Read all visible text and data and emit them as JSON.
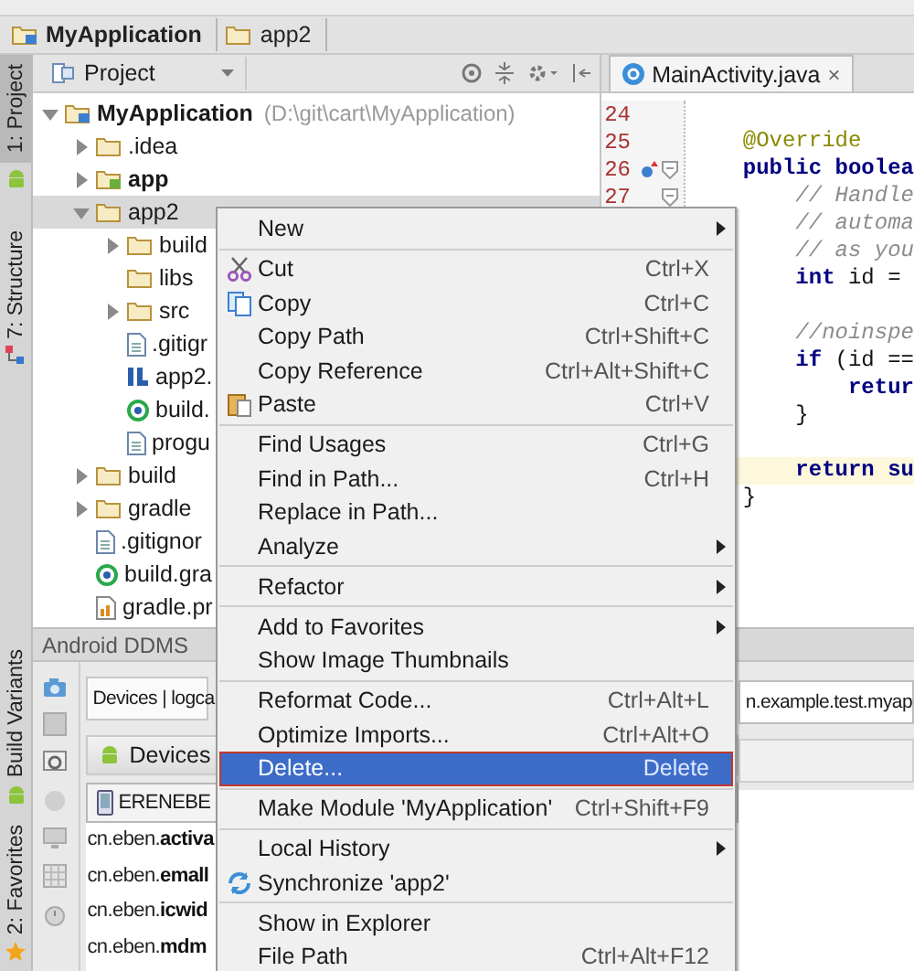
{
  "breadcrumb": [
    {
      "label": "MyApplication",
      "kind": "project"
    },
    {
      "label": "app2",
      "kind": "folder"
    }
  ],
  "sidebar_tabs": [
    {
      "label": "1: Project",
      "selected": true,
      "kind": "project"
    },
    {
      "label": "7: Structure",
      "selected": false,
      "kind": "structure"
    },
    {
      "label": "Build Variants",
      "selected": false,
      "kind": "variants"
    },
    {
      "label": "2: Favorites",
      "selected": false,
      "kind": "favorites"
    }
  ],
  "project_panel": {
    "view": "Project",
    "tree": [
      {
        "label": "MyApplication",
        "path": "(D:\\git\\cart\\MyApplication)",
        "kind": "project",
        "expanded": true,
        "selected": false,
        "children": [
          {
            "label": ".idea",
            "kind": "folder",
            "expanded": false,
            "selected": false
          },
          {
            "label": "app",
            "kind": "module",
            "expanded": false,
            "selected": false
          },
          {
            "label": "app2",
            "kind": "folder",
            "expanded": true,
            "selected": true,
            "children": [
              {
                "label": "build",
                "kind": "folder",
                "expanded": false,
                "selected": false
              },
              {
                "label": "libs",
                "kind": "folder",
                "selected": false
              },
              {
                "label": "src",
                "kind": "folder",
                "expanded": false,
                "selected": false
              },
              {
                "label": ".gitigr",
                "kind": "file",
                "selected": false
              },
              {
                "label": "app2.",
                "kind": "iml",
                "selected": false
              },
              {
                "label": "build.",
                "kind": "gradle",
                "selected": false
              },
              {
                "label": "progu",
                "kind": "file",
                "selected": false
              }
            ]
          },
          {
            "label": "build",
            "kind": "folder",
            "expanded": false,
            "selected": false
          },
          {
            "label": "gradle",
            "kind": "folder",
            "expanded": false,
            "selected": false
          },
          {
            "label": ".gitignor",
            "kind": "file",
            "selected": false
          },
          {
            "label": "build.gra",
            "kind": "gradle",
            "selected": false
          },
          {
            "label": "gradle.pr",
            "kind": "properties",
            "selected": false
          }
        ]
      }
    ]
  },
  "editor": {
    "tab": {
      "label": "MainActivity.java",
      "close": "×"
    },
    "line_numbers": [
      {
        "number": "24",
        "override": false,
        "fold": false
      },
      {
        "number": "25",
        "override": false,
        "fold": false
      },
      {
        "number": "26",
        "override": true,
        "fold": true
      },
      {
        "number": "27",
        "override": false,
        "fold": true
      }
    ],
    "lines": [
      {
        "kind": "blank"
      },
      {
        "text": "    @Override",
        "kind": "annotation",
        "highlighted": false
      },
      {
        "text": "    **public boolea**",
        "kind": "code",
        "highlighted": false
      },
      {
        "text": "        // Handle",
        "kind": "comment",
        "highlighted": false
      },
      {
        "text": "        // automa",
        "kind": "comment",
        "highlighted": false
      },
      {
        "text": "        // as you",
        "kind": "comment",
        "highlighted": false
      },
      {
        "text": "        **int** id =",
        "kind": "code",
        "highlighted": false
      },
      {
        "kind": "blank"
      },
      {
        "text": "        //noinspe",
        "kind": "comment",
        "highlighted": false
      },
      {
        "text": "        **if** (id ==",
        "kind": "code",
        "highlighted": false
      },
      {
        "text": "            **retur**",
        "kind": "code",
        "highlighted": false
      },
      {
        "text": "        }",
        "kind": "code",
        "highlighted": false
      },
      {
        "kind": "blank"
      },
      {
        "text": "        **return su**",
        "kind": "code",
        "highlighted": true
      },
      {
        "text": "    }",
        "kind": "code",
        "highlighted": false
      }
    ]
  },
  "ddms": {
    "title": "Android DDMS",
    "tab": "Devices | logca",
    "devices_header": "Devices",
    "device": "ERENEBE",
    "processes": [
      "cn.eben.**activa**",
      "cn.eben.**emall**",
      "cn.eben.**icwid**",
      "cn.eben.**mdm**"
    ],
    "filter": "n.example.test.myap"
  },
  "context_menu": {
    "items": [
      {
        "kind": "item",
        "label": "New",
        "submenu": true,
        "selected": false
      },
      {
        "kind": "separator"
      },
      {
        "kind": "cut",
        "label": "Cut",
        "shortcut": "Ctrl+X",
        "submenu": false,
        "selected": false
      },
      {
        "kind": "copy",
        "label": "Copy",
        "shortcut": "Ctrl+C",
        "submenu": false,
        "selected": false
      },
      {
        "kind": "item",
        "label": "Copy Path",
        "shortcut": "Ctrl+Shift+C",
        "submenu": false,
        "selected": false
      },
      {
        "kind": "item",
        "label": "Copy Reference",
        "shortcut": "Ctrl+Alt+Shift+C",
        "submenu": false,
        "selected": false
      },
      {
        "kind": "paste",
        "label": "Paste",
        "shortcut": "Ctrl+V",
        "submenu": false,
        "selected": false
      },
      {
        "kind": "separator"
      },
      {
        "kind": "item",
        "label": "Find Usages",
        "shortcut": "Ctrl+G",
        "submenu": false,
        "selected": false
      },
      {
        "kind": "item",
        "label": "Find in Path...",
        "shortcut": "Ctrl+H",
        "submenu": false,
        "selected": false
      },
      {
        "kind": "item",
        "label": "Replace in Path...",
        "submenu": false,
        "selected": false
      },
      {
        "kind": "item",
        "label": "Analyze",
        "submenu": true,
        "selected": false
      },
      {
        "kind": "separator"
      },
      {
        "kind": "item",
        "label": "Refactor",
        "submenu": true,
        "selected": false
      },
      {
        "kind": "separator"
      },
      {
        "kind": "item",
        "label": "Add to Favorites",
        "submenu": true,
        "selected": false
      },
      {
        "kind": "item",
        "label": "Show Image Thumbnails",
        "submenu": false,
        "selected": false
      },
      {
        "kind": "separator"
      },
      {
        "kind": "item",
        "label": "Reformat Code...",
        "shortcut": "Ctrl+Alt+L",
        "submenu": false,
        "selected": false
      },
      {
        "kind": "item",
        "label": "Optimize Imports...",
        "shortcut": "Ctrl+Alt+O",
        "submenu": false,
        "selected": false
      },
      {
        "kind": "item",
        "label": "Delete...",
        "shortcut": "Delete",
        "submenu": false,
        "selected": true
      },
      {
        "kind": "separator"
      },
      {
        "kind": "item",
        "label": "Make Module 'MyApplication'",
        "shortcut": "Ctrl+Shift+F9",
        "submenu": false,
        "selected": false
      },
      {
        "kind": "separator"
      },
      {
        "kind": "item",
        "label": "Local History",
        "submenu": true,
        "selected": false
      },
      {
        "kind": "sync",
        "label": "Synchronize 'app2'",
        "submenu": false,
        "selected": false
      },
      {
        "kind": "separator"
      },
      {
        "kind": "item",
        "label": "Show in Explorer",
        "submenu": false,
        "selected": false
      },
      {
        "kind": "item",
        "label": "File Path",
        "shortcut": "Ctrl+Alt+F12",
        "submenu": false,
        "selected": false
      }
    ]
  }
}
